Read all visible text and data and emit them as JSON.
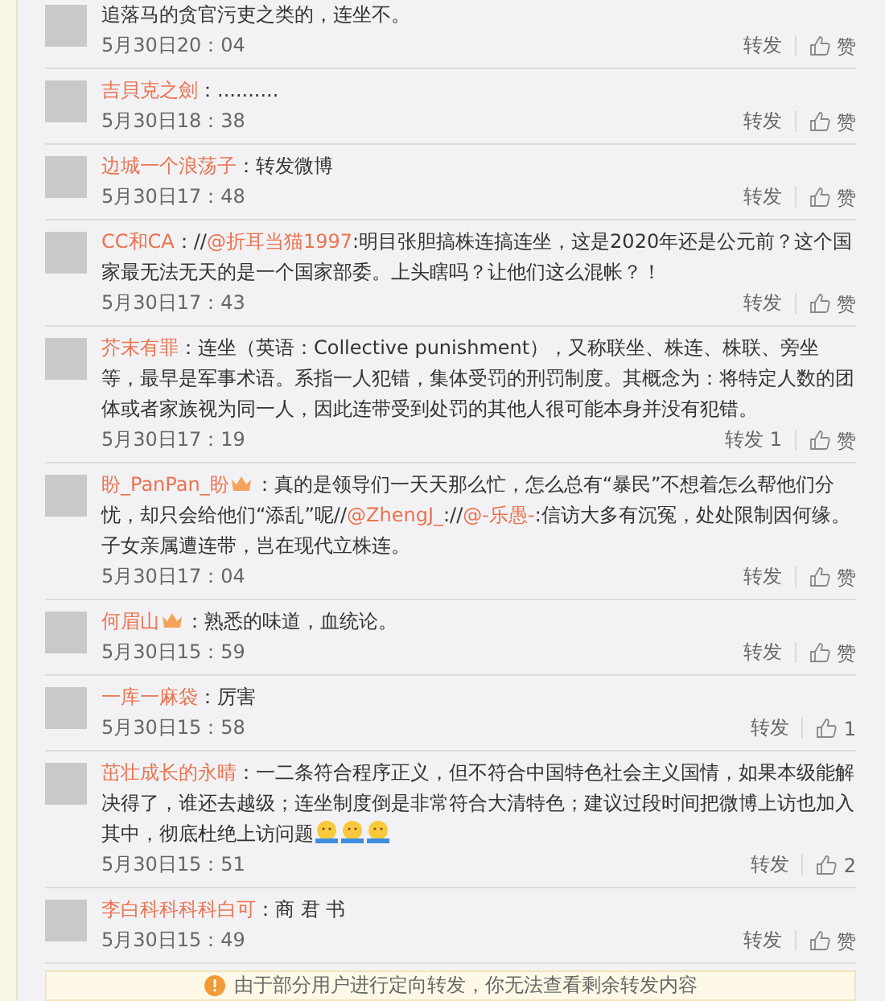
{
  "reposts": [
    {
      "vip": false,
      "content": [
        {
          "text": "追落马的贪官污吏之类的，连坐不。",
          "link": false
        }
      ],
      "time": "5月30日20：04",
      "repost": "转发",
      "like": "赞"
    },
    {
      "name": "吉貝克之劍",
      "vip": false,
      "content": [
        {
          "text": "：..........",
          "link": false
        }
      ],
      "time": "5月30日18：38",
      "repost": "转发",
      "like": "赞"
    },
    {
      "name": "边城一个浪荡子",
      "vip": false,
      "content": [
        {
          "text": "：转发微博",
          "link": false
        }
      ],
      "time": "5月30日17：48",
      "repost": "转发",
      "like": "赞"
    },
    {
      "name": "CC和CA",
      "vip": false,
      "content": [
        {
          "text": "：//",
          "link": false
        },
        {
          "text": "@折耳当猫1997",
          "link": true
        },
        {
          "text": ":明目张胆搞株连搞连坐，这是2020年还是公元前？这个国家最无法无天的是一个国家部委。上头瞎吗？让他们这么混帐？！",
          "link": false
        }
      ],
      "time": "5月30日17：43",
      "repost": "转发",
      "like": "赞"
    },
    {
      "name": "芥末有罪",
      "vip": false,
      "content": [
        {
          "text": "：连坐（英语：Collective punishment），又称联坐、株连、株联、旁坐等，最早是军事术语。系指一人犯错，集体受罚的刑罚制度。其概念为：将特定人数的团体或者家族视为同一人，因此连带受到处罚的其他人很可能本身并没有犯错。",
          "link": false
        }
      ],
      "time": "5月30日17：19",
      "repost": "转发 1",
      "like": "赞"
    },
    {
      "name": "盼_PanPan_盼",
      "vip": true,
      "content": [
        {
          "text": "：真的是领导们一天天那么忙，怎么总有“暴民”不想着怎么帮他们分忧，却只会给他们“添乱”呢//",
          "link": false
        },
        {
          "text": "@ZhengJ_",
          "link": true
        },
        {
          "text": "://",
          "link": false
        },
        {
          "text": "@-乐愚-",
          "link": true
        },
        {
          "text": ":信访大多有沉冤，处处限制因何缘。子女亲属遭连带，岂在现代立株连。",
          "link": false
        }
      ],
      "time": "5月30日17：04",
      "repost": "转发",
      "like": "赞"
    },
    {
      "name": "何眉山",
      "vip": true,
      "content": [
        {
          "text": "：熟悉的味道，血统论。",
          "link": false
        }
      ],
      "time": "5月30日15：59",
      "repost": "转发",
      "like": "赞"
    },
    {
      "name": "一库一麻袋",
      "vip": false,
      "content": [
        {
          "text": "：厉害",
          "link": false
        }
      ],
      "time": "5月30日15：58",
      "repost": "转发",
      "like": "1"
    },
    {
      "name": "茁壮成长的永晴",
      "vip": false,
      "content": [
        {
          "text": "：一二条符合程序正义，但不符合中国特色社会主义国情，如果本级能解决得了，谁还去越级；连坐制度倒是非常符合大清特色；建议过段时间把微博上访也加入其中，彻底杜绝上访问题",
          "link": false
        }
      ],
      "emojis": [
        {
          "kind": "hug"
        },
        {
          "kind": "hug"
        },
        {
          "kind": "hug"
        }
      ],
      "time": "5月30日15：51",
      "repost": "转发",
      "like": "2"
    },
    {
      "name": "李白科科科科白可",
      "vip": false,
      "content": [
        {
          "text": "：商 君 书",
          "link": false
        }
      ],
      "time": "5月30日15：49",
      "repost": "转发",
      "like": "赞"
    }
  ],
  "notice": {
    "text": "由于部分用户进行定向转发，你无法查看剩余转发内容"
  }
}
